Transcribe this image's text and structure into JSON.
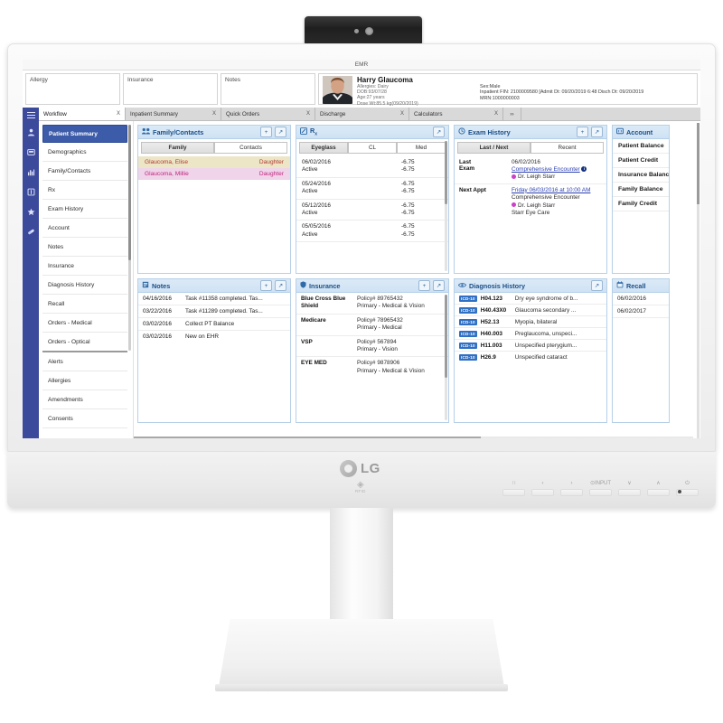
{
  "app": {
    "title": "EMR"
  },
  "topstrip": {
    "tiles": [
      {
        "label": "Allergy"
      },
      {
        "label": "Insurance"
      },
      {
        "label": "Notes"
      }
    ],
    "patient": {
      "name": "Harry Glaucoma",
      "allergies": "Allergies: Dairy",
      "dob": "DOB:93/07/28",
      "age": "Age:27 years",
      "dose_weight": "Dose Wt:85.5 kg(09/20/2019)",
      "sex": "Sex:Male",
      "encounter": "Inpatient FIN: 2100009580 [Admit Dt: 09/20/2019 6:48 Disch Dt: 09/20/2019",
      "mrn": "MRN:1000000003"
    }
  },
  "rail": {
    "icons": [
      {
        "name": "menu-icon",
        "glyph": ""
      },
      {
        "name": "person-icon",
        "glyph": "♟"
      },
      {
        "name": "chart-card-icon",
        "glyph": "▣"
      },
      {
        "name": "bar-chart-icon",
        "glyph": "▐"
      },
      {
        "name": "book-icon",
        "glyph": "▢"
      },
      {
        "name": "star-icon",
        "glyph": "★"
      },
      {
        "name": "pill-icon",
        "glyph": "●"
      }
    ]
  },
  "tabs": [
    {
      "label": "Workflow",
      "close": "X",
      "active": true
    },
    {
      "label": "Inpatient Summary",
      "close": "X",
      "active": false
    },
    {
      "label": "Quick Orders",
      "close": "X",
      "active": false
    },
    {
      "label": "Discharge",
      "close": "X",
      "active": false
    },
    {
      "label": "Calculators",
      "close": "X",
      "active": false
    },
    {
      "label": "››",
      "close": "",
      "active": false
    }
  ],
  "nav": {
    "items": [
      {
        "label": "Patient Summary",
        "active": true
      },
      {
        "label": "Demographics",
        "active": false
      },
      {
        "label": "Family/Contacts",
        "active": false
      },
      {
        "label": "Rx",
        "active": false
      },
      {
        "label": "Exam History",
        "active": false
      },
      {
        "label": "Account",
        "active": false
      },
      {
        "label": "Notes",
        "active": false
      },
      {
        "label": "Insurance",
        "active": false
      },
      {
        "label": "Diagnosis History",
        "active": false
      },
      {
        "label": "Recall",
        "active": false
      },
      {
        "label": "Orders - Medical",
        "active": false
      },
      {
        "label": "Orders - Optical",
        "active": false
      },
      {
        "label": "Alerts",
        "active": false
      },
      {
        "label": "Allergies",
        "active": false
      },
      {
        "label": "Amendments",
        "active": false
      },
      {
        "label": "Consents",
        "active": false
      }
    ]
  },
  "panels": {
    "family": {
      "title": "Family/Contacts",
      "icon": "people-icon",
      "add_label": "+",
      "expand_label": "↗",
      "segments": [
        {
          "label": "Family",
          "selected": true
        },
        {
          "label": "Contacts",
          "selected": false
        }
      ],
      "rows": [
        {
          "name": "Glaucoma, Elise",
          "relation": "Daughter"
        },
        {
          "name": "Glaucoma, Millie",
          "relation": "Daughter"
        }
      ]
    },
    "rx": {
      "title": "R",
      "title_sub": "x",
      "icon": "prescription-icon",
      "expand_label": "↗",
      "segments": [
        {
          "label": "Eyeglass",
          "selected": true
        },
        {
          "label": "CL",
          "selected": false
        },
        {
          "label": "Med",
          "selected": false
        }
      ],
      "rows": [
        {
          "date": "06/02/2016",
          "status": "Active",
          "od": "-6.75",
          "os": "-6.75"
        },
        {
          "date": "05/24/2016",
          "status": "Active",
          "od": "-6.75",
          "os": "-6.75"
        },
        {
          "date": "05/12/2016",
          "status": "Active",
          "od": "-6.75",
          "os": "-6.75"
        },
        {
          "date": "05/05/2016",
          "status": "Active",
          "od": "-6.75",
          "os": "-6.75"
        }
      ]
    },
    "exam": {
      "title": "Exam History",
      "icon": "history-clock-icon",
      "add_label": "+",
      "expand_label": "↗",
      "segments": [
        {
          "label": "Last / Next",
          "selected": true
        },
        {
          "label": "Recent",
          "selected": false
        }
      ],
      "last": {
        "key1": "Last",
        "key2": "Exam",
        "date": "06/02/2016",
        "encounter": "Comprehensive Encounter",
        "info_badge": "i",
        "doctor": "Dr. Leigh Starr"
      },
      "next": {
        "key": "Next Appt",
        "when": "Friday 06/03/2016 at 10:00 AM",
        "encounter": "Comprehensive Encounter",
        "doctor": "Dr. Leigh Starr",
        "location": "Starr Eye Care"
      }
    },
    "account": {
      "title": "Account",
      "icon": "account-icon",
      "rows": [
        {
          "label": "Patient Balance"
        },
        {
          "label": "Patient Credit"
        },
        {
          "label": "Insurance Balance"
        },
        {
          "label": "Family Balance"
        },
        {
          "label": "Family Credit"
        }
      ]
    },
    "notes": {
      "title": "Notes",
      "icon": "notes-icon",
      "add_label": "+",
      "expand_label": "↗",
      "rows": [
        {
          "date": "04/16/2016",
          "text": "Task #11358 completed. Tas..."
        },
        {
          "date": "03/22/2016",
          "text": "Task #11289 completed. Tas..."
        },
        {
          "date": "03/02/2016",
          "text": "Collect PT Balance"
        },
        {
          "date": "03/02/2016",
          "text": "New on EHR"
        }
      ]
    },
    "insurance": {
      "title": "Insurance",
      "icon": "shield-icon",
      "add_label": "+",
      "expand_label": "↗",
      "rows": [
        {
          "name": "Blue Cross Blue Shield",
          "policy": "Policy# 89765432",
          "plan": "Primary - Medical & Vision"
        },
        {
          "name": "Medicare",
          "policy": "Policy# 78965432",
          "plan": "Primary - Medical"
        },
        {
          "name": "VSP",
          "policy": "Policy# 567894",
          "plan": "Primary - Vision"
        },
        {
          "name": "EYE MED",
          "policy": "Policy# 9878906",
          "plan": "Primary - Medical & Vision"
        }
      ]
    },
    "diagnosis": {
      "title": "Diagnosis History",
      "icon": "eye-icon",
      "expand_label": "↗",
      "badge": "ICD-10",
      "rows": [
        {
          "code": "H04.123",
          "desc": "Dry eye syndrome of b..."
        },
        {
          "code": "H40.43X0",
          "desc": "Glaucoma secondary ..."
        },
        {
          "code": "H52.13",
          "desc": "Myopia, bilateral"
        },
        {
          "code": "H40.003",
          "desc": "Preglaucoma, unspeci..."
        },
        {
          "code": "H11.003",
          "desc": "Unspecified pterygium..."
        },
        {
          "code": "H26.9",
          "desc": "Unspecified cataract"
        }
      ]
    },
    "recall": {
      "title": "Recall",
      "icon": "calendar-icon",
      "rows": [
        {
          "date": "06/02/2016"
        },
        {
          "date": "06/02/2017"
        }
      ]
    }
  },
  "monitor": {
    "brand": "LG",
    "rfid_label": "RFID",
    "osd_keys": [
      {
        "glyph": "∷",
        "name": "menu-key"
      },
      {
        "glyph": "‹",
        "name": "left-key"
      },
      {
        "glyph": "›",
        "name": "right-key"
      },
      {
        "glyph": "⊙INPUT",
        "name": "input-key"
      },
      {
        "glyph": "∨",
        "name": "down-key"
      },
      {
        "glyph": "∧",
        "name": "up-key"
      },
      {
        "glyph": "⏻",
        "name": "power-key"
      }
    ]
  },
  "colors": {
    "rail": "#3c4a9c",
    "nav_active": "#3c5ba9",
    "panel_header": "#cfe2f4",
    "panel_title": "#1b4f87",
    "icd_badge": "#2f6fc4",
    "doctor_dot": "#cc3fc8",
    "link": "#2a3fb0"
  }
}
